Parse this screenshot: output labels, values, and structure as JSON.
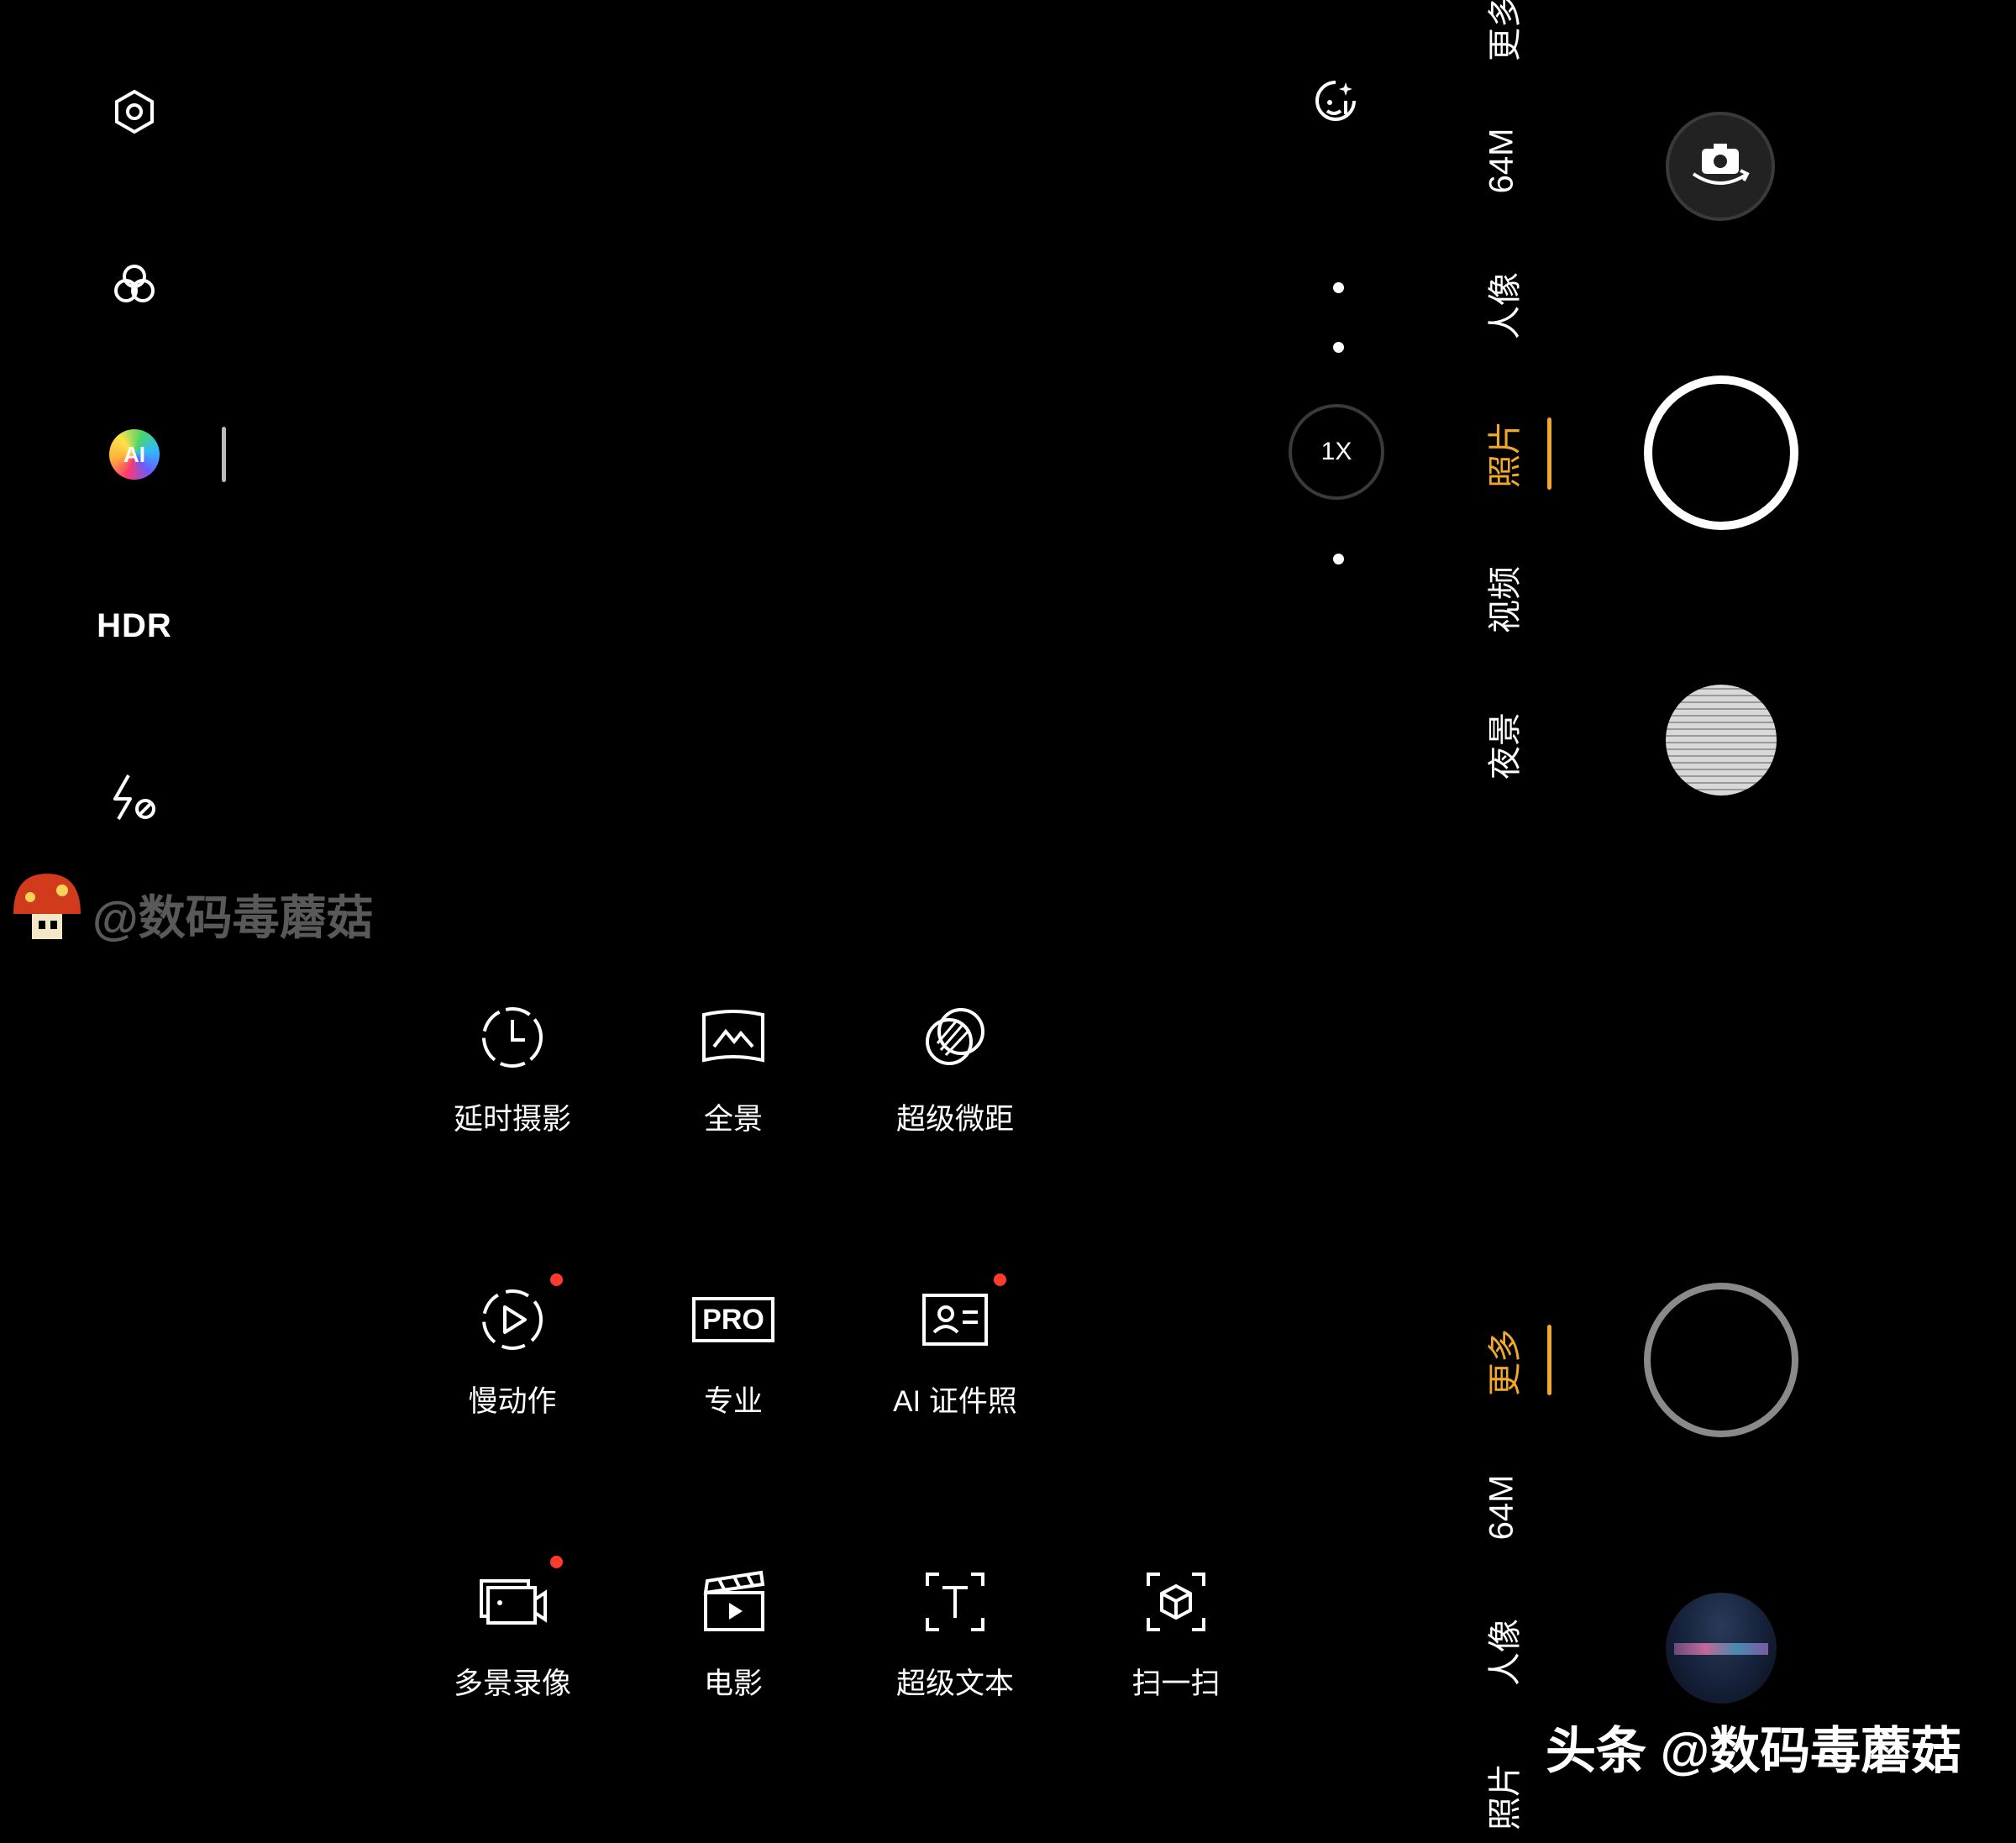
{
  "left_toolbar": {
    "settings_icon": "settings-hexagon-icon",
    "filter_icon": "filter-circles-icon",
    "ai_label": "AI",
    "hdr_label": "HDR",
    "flash_icon": "flash-off-icon"
  },
  "watermark_top": "@数码毒蘑菇",
  "watermark_bottom": "头条 @数码毒蘑菇",
  "zoom": {
    "label": "1X"
  },
  "top_mode_strip": [
    "更多",
    "64M",
    "人像",
    "照片",
    "视频",
    "夜景"
  ],
  "top_active_mode": "照片",
  "bottom_mode_strip": [
    "更多",
    "64M",
    "人像",
    "照片"
  ],
  "bottom_active_mode": "更多",
  "more_modes": [
    {
      "label": "延时摄影",
      "icon": "timelapse-icon",
      "new": false
    },
    {
      "label": "全景",
      "icon": "panorama-icon",
      "new": false
    },
    {
      "label": "超级微距",
      "icon": "macro-icon",
      "new": false
    },
    {
      "label": "慢动作",
      "icon": "slow-motion-icon",
      "new": true
    },
    {
      "label": "专业",
      "icon": "pro-icon",
      "icon_text": "PRO",
      "new": false
    },
    {
      "label": "AI 证件照",
      "icon": "id-photo-icon",
      "new": true
    },
    {
      "label": "多景录像",
      "icon": "multi-scene-video-icon",
      "new": true
    },
    {
      "label": "电影",
      "icon": "movie-clapper-icon",
      "new": false
    },
    {
      "label": "超级文本",
      "icon": "super-text-icon",
      "new": false
    },
    {
      "label": "扫一扫",
      "icon": "scan-icon",
      "new": false
    }
  ],
  "colors": {
    "accent": "#f2a92a",
    "new_badge": "#ff3b2f",
    "background": "#000000"
  }
}
